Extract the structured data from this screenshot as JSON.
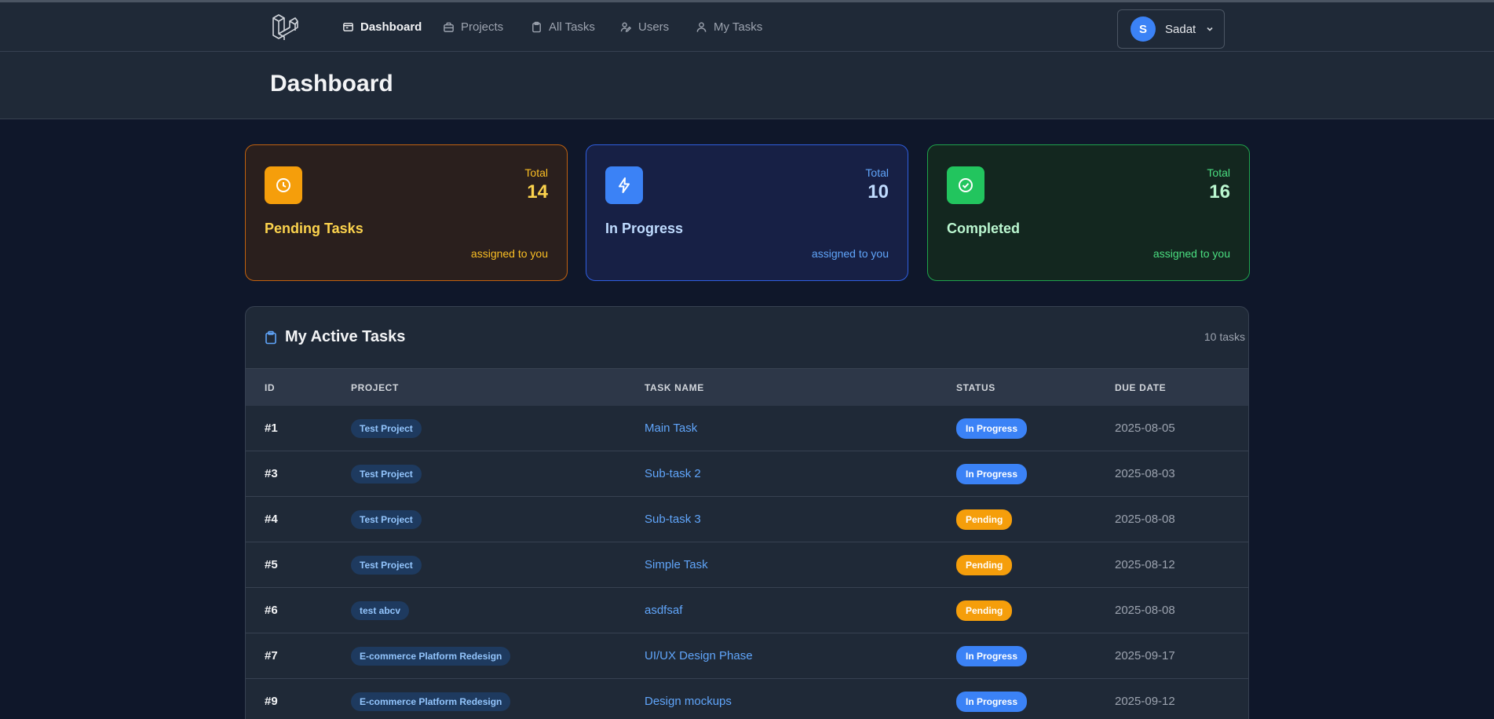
{
  "nav": {
    "items": [
      {
        "label": "Dashboard",
        "icon": "dashboard-icon",
        "active": true
      },
      {
        "label": "Projects",
        "icon": "briefcase-icon",
        "active": false
      },
      {
        "label": "All Tasks",
        "icon": "clipboard-icon",
        "active": false
      },
      {
        "label": "Users",
        "icon": "user-edit-icon",
        "active": false
      },
      {
        "label": "My Tasks",
        "icon": "user-icon",
        "active": false
      }
    ],
    "user": {
      "initial": "S",
      "name": "Sadat"
    }
  },
  "header": {
    "title": "Dashboard"
  },
  "stats": {
    "pending": {
      "total_label": "Total",
      "total": "14",
      "title": "Pending Tasks",
      "sub": "assigned to you"
    },
    "progress": {
      "total_label": "Total",
      "total": "10",
      "title": "In Progress",
      "sub": "assigned to you"
    },
    "completed": {
      "total_label": "Total",
      "total": "16",
      "title": "Completed",
      "sub": "assigned to you"
    }
  },
  "tasks": {
    "title": "My Active Tasks",
    "count": "10 tasks",
    "columns": [
      "ID",
      "PROJECT",
      "TASK NAME",
      "STATUS",
      "DUE DATE"
    ],
    "rows": [
      {
        "id": "#1",
        "project": "Test Project",
        "task": "Main Task",
        "status": "In Progress",
        "due": "2025-08-05"
      },
      {
        "id": "#3",
        "project": "Test Project",
        "task": "Sub-task 2",
        "status": "In Progress",
        "due": "2025-08-03"
      },
      {
        "id": "#4",
        "project": "Test Project",
        "task": "Sub-task 3",
        "status": "Pending",
        "due": "2025-08-08"
      },
      {
        "id": "#5",
        "project": "Test Project",
        "task": "Simple Task",
        "status": "Pending",
        "due": "2025-08-12"
      },
      {
        "id": "#6",
        "project": "test abcv",
        "task": "asdfsaf",
        "status": "Pending",
        "due": "2025-08-08"
      },
      {
        "id": "#7",
        "project": "E-commerce Platform Redesign",
        "task": "UI/UX Design Phase",
        "status": "In Progress",
        "due": "2025-09-17"
      },
      {
        "id": "#9",
        "project": "E-commerce Platform Redesign",
        "task": "Design mockups",
        "status": "In Progress",
        "due": "2025-09-12"
      }
    ]
  },
  "colors": {
    "background": "#0f172a",
    "surface": "#1f2937",
    "accent": "#6366f1",
    "pending": "#f59e0b",
    "in_progress": "#3b82f6",
    "completed": "#22c55e"
  }
}
